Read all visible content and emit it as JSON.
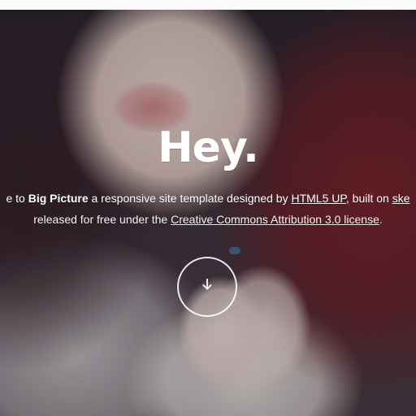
{
  "hero": {
    "headline": "Hey.",
    "intro": {
      "prefix": "e to ",
      "brand": "Big Picture",
      "middle": " a responsive site template designed by ",
      "author_link": "HTML5 UP",
      "after_author": ", built on ",
      "trailing_link": "ske"
    },
    "license": {
      "prefix": "released for free under the ",
      "link": "Creative Commons Attribution 3.0 license",
      "suffix": "."
    },
    "scroll_icon": "arrow-down-icon"
  }
}
